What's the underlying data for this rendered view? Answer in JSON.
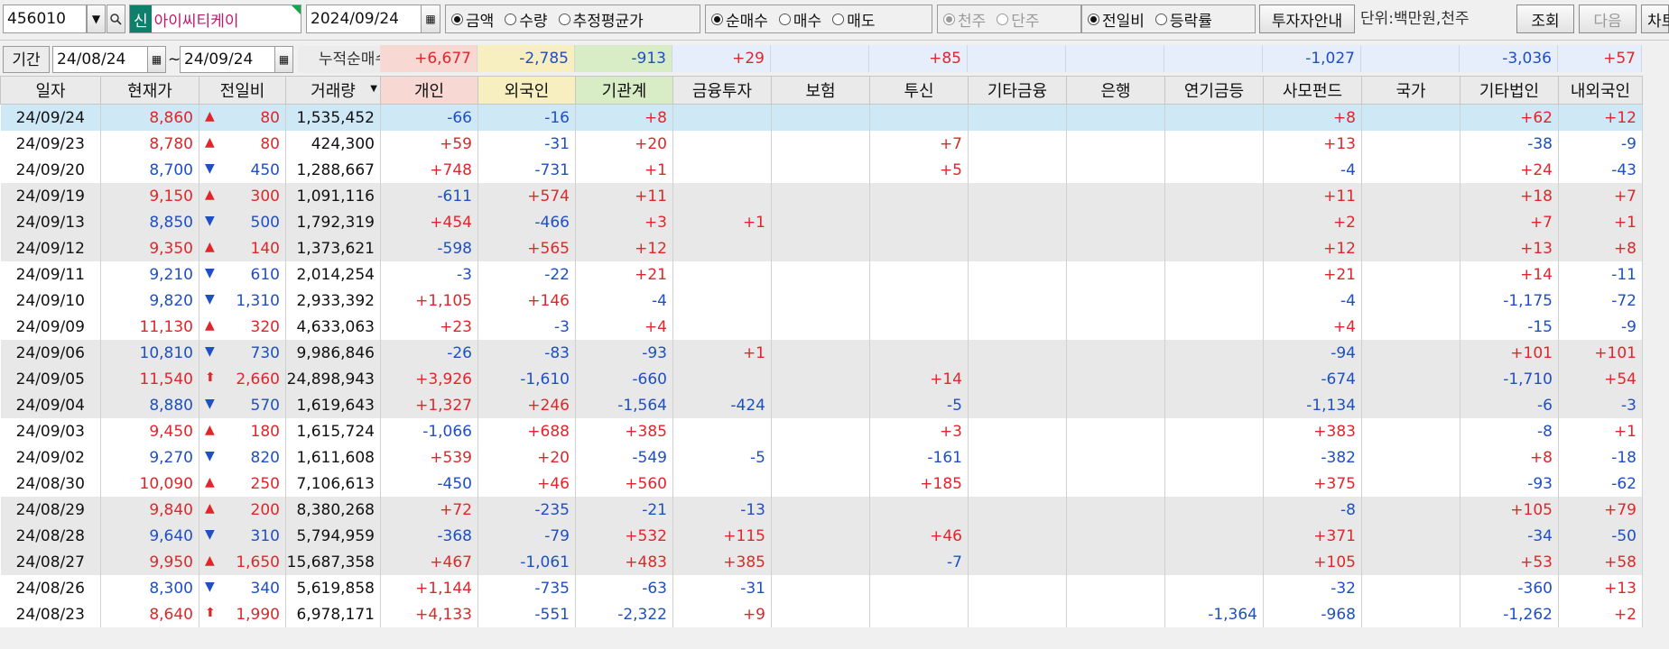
{
  "toolbar": {
    "code": "456010",
    "market_badge": "신",
    "stock_name": "아이씨티케이",
    "date": "2024/09/24",
    "radio_groups": [
      {
        "options": [
          "금액",
          "수량",
          "추정평균가"
        ],
        "selected": 0
      },
      {
        "options": [
          "순매수",
          "매수",
          "매도"
        ],
        "selected": 0
      },
      {
        "options": [
          "천주",
          "단주"
        ],
        "selected": 0,
        "disabled": true
      },
      {
        "options": [
          "전일비",
          "등락률"
        ],
        "selected": 0
      }
    ],
    "investor_button": "투자자안내",
    "unit_label": "단위:백만원,천주",
    "search_button": "조회",
    "next_button": "다음",
    "chart_button": "차트"
  },
  "period": {
    "label": "기간",
    "from": "24/08/24",
    "tilde": "~",
    "to": "24/09/24",
    "cum_label": "누적순매수"
  },
  "summary": [
    "+6,677",
    "-2,785",
    "-913",
    "+29",
    "",
    "+85",
    "",
    "",
    "",
    "-1,027",
    "",
    "-3,036",
    "+57"
  ],
  "colors": {
    "up": "#e0262b",
    "down": "#1f4fc4",
    "selected_row": "#cfe8f5",
    "gray_row": "#e8e8e8"
  },
  "table": {
    "headers": [
      "일자",
      "현재가",
      "전일비",
      "거래량",
      "개인",
      "외국인",
      "기관계",
      "금융투자",
      "보험",
      "투신",
      "기타금융",
      "은행",
      "연기금등",
      "사모펀드",
      "국가",
      "기타법인",
      "내외국인"
    ],
    "rows": [
      {
        "shade": "sel",
        "date": "24/09/24",
        "price": "8,860",
        "dir": "up",
        "arrow": "▲",
        "change": "80",
        "volume": "1,535,452",
        "vals": [
          "-66",
          "-16",
          "+8",
          "",
          "",
          "",
          "",
          "",
          "",
          "+8",
          "",
          "+62",
          "+12"
        ]
      },
      {
        "shade": "white",
        "date": "24/09/23",
        "price": "8,780",
        "dir": "up",
        "arrow": "▲",
        "change": "80",
        "volume": "424,300",
        "vals": [
          "+59",
          "-31",
          "+20",
          "",
          "",
          "+7",
          "",
          "",
          "",
          "+13",
          "",
          "-38",
          "-9"
        ]
      },
      {
        "shade": "white",
        "date": "24/09/20",
        "price": "8,700",
        "dir": "down",
        "arrow": "▼",
        "change": "450",
        "volume": "1,288,667",
        "vals": [
          "+748",
          "-731",
          "+1",
          "",
          "",
          "+5",
          "",
          "",
          "",
          "-4",
          "",
          "+24",
          "-43"
        ]
      },
      {
        "shade": "gray",
        "date": "24/09/19",
        "price": "9,150",
        "dir": "up",
        "arrow": "▲",
        "change": "300",
        "volume": "1,091,116",
        "vals": [
          "-611",
          "+574",
          "+11",
          "",
          "",
          "",
          "",
          "",
          "",
          "+11",
          "",
          "+18",
          "+7"
        ]
      },
      {
        "shade": "gray",
        "date": "24/09/13",
        "price": "8,850",
        "dir": "down",
        "arrow": "▼",
        "change": "500",
        "volume": "1,792,319",
        "vals": [
          "+454",
          "-466",
          "+3",
          "+1",
          "",
          "",
          "",
          "",
          "",
          "+2",
          "",
          "+7",
          "+1"
        ]
      },
      {
        "shade": "gray",
        "date": "24/09/12",
        "price": "9,350",
        "dir": "up",
        "arrow": "▲",
        "change": "140",
        "volume": "1,373,621",
        "vals": [
          "-598",
          "+565",
          "+12",
          "",
          "",
          "",
          "",
          "",
          "",
          "+12",
          "",
          "+13",
          "+8"
        ]
      },
      {
        "shade": "white",
        "date": "24/09/11",
        "price": "9,210",
        "dir": "down",
        "arrow": "▼",
        "change": "610",
        "volume": "2,014,254",
        "vals": [
          "-3",
          "-22",
          "+21",
          "",
          "",
          "",
          "",
          "",
          "",
          "+21",
          "",
          "+14",
          "-11"
        ]
      },
      {
        "shade": "white",
        "date": "24/09/10",
        "price": "9,820",
        "dir": "down",
        "arrow": "▼",
        "change": "1,310",
        "volume": "2,933,392",
        "vals": [
          "+1,105",
          "+146",
          "-4",
          "",
          "",
          "",
          "",
          "",
          "",
          "-4",
          "",
          "-1,175",
          "-72"
        ]
      },
      {
        "shade": "white",
        "date": "24/09/09",
        "price": "11,130",
        "dir": "up",
        "arrow": "▲",
        "change": "320",
        "volume": "4,633,063",
        "vals": [
          "+23",
          "-3",
          "+4",
          "",
          "",
          "",
          "",
          "",
          "",
          "+4",
          "",
          "-15",
          "-9"
        ]
      },
      {
        "shade": "gray",
        "date": "24/09/06",
        "price": "10,810",
        "dir": "down",
        "arrow": "▼",
        "change": "730",
        "volume": "9,986,846",
        "vals": [
          "-26",
          "-83",
          "-93",
          "+1",
          "",
          "",
          "",
          "",
          "",
          "-94",
          "",
          "+101",
          "+101"
        ]
      },
      {
        "shade": "gray",
        "date": "24/09/05",
        "price": "11,540",
        "dir": "up",
        "arrow": "⬆",
        "change": "2,660",
        "volume": "24,898,943",
        "vals": [
          "+3,926",
          "-1,610",
          "-660",
          "",
          "",
          "+14",
          "",
          "",
          "",
          "-674",
          "",
          "-1,710",
          "+54"
        ]
      },
      {
        "shade": "gray",
        "date": "24/09/04",
        "price": "8,880",
        "dir": "down",
        "arrow": "▼",
        "change": "570",
        "volume": "1,619,643",
        "vals": [
          "+1,327",
          "+246",
          "-1,564",
          "-424",
          "",
          "-5",
          "",
          "",
          "",
          "-1,134",
          "",
          "-6",
          "-3"
        ]
      },
      {
        "shade": "white",
        "date": "24/09/03",
        "price": "9,450",
        "dir": "up",
        "arrow": "▲",
        "change": "180",
        "volume": "1,615,724",
        "vals": [
          "-1,066",
          "+688",
          "+385",
          "",
          "",
          "+3",
          "",
          "",
          "",
          "+383",
          "",
          "-8",
          "+1"
        ]
      },
      {
        "shade": "white",
        "date": "24/09/02",
        "price": "9,270",
        "dir": "down",
        "arrow": "▼",
        "change": "820",
        "volume": "1,611,608",
        "vals": [
          "+539",
          "+20",
          "-549",
          "-5",
          "",
          "-161",
          "",
          "",
          "",
          "-382",
          "",
          "+8",
          "-18"
        ]
      },
      {
        "shade": "white",
        "date": "24/08/30",
        "price": "10,090",
        "dir": "up",
        "arrow": "▲",
        "change": "250",
        "volume": "7,106,613",
        "vals": [
          "-450",
          "+46",
          "+560",
          "",
          "",
          "+185",
          "",
          "",
          "",
          "+375",
          "",
          "-93",
          "-62"
        ]
      },
      {
        "shade": "gray",
        "date": "24/08/29",
        "price": "9,840",
        "dir": "up",
        "arrow": "▲",
        "change": "200",
        "volume": "8,380,268",
        "vals": [
          "+72",
          "-235",
          "-21",
          "-13",
          "",
          "",
          "",
          "",
          "",
          "-8",
          "",
          "+105",
          "+79"
        ]
      },
      {
        "shade": "gray",
        "date": "24/08/28",
        "price": "9,640",
        "dir": "down",
        "arrow": "▼",
        "change": "310",
        "volume": "5,794,959",
        "vals": [
          "-368",
          "-79",
          "+532",
          "+115",
          "",
          "+46",
          "",
          "",
          "",
          "+371",
          "",
          "-34",
          "-50"
        ]
      },
      {
        "shade": "gray",
        "date": "24/08/27",
        "price": "9,950",
        "dir": "up",
        "arrow": "▲",
        "change": "1,650",
        "volume": "15,687,358",
        "vals": [
          "+467",
          "-1,061",
          "+483",
          "+385",
          "",
          "-7",
          "",
          "",
          "",
          "+105",
          "",
          "+53",
          "+58"
        ]
      },
      {
        "shade": "white",
        "date": "24/08/26",
        "price": "8,300",
        "dir": "down",
        "arrow": "▼",
        "change": "340",
        "volume": "5,619,858",
        "vals": [
          "+1,144",
          "-735",
          "-63",
          "-31",
          "",
          "",
          "",
          "",
          "",
          "-32",
          "",
          "-360",
          "+13"
        ]
      },
      {
        "shade": "white",
        "date": "24/08/23",
        "price": "8,640",
        "dir": "up",
        "arrow": "⬆",
        "change": "1,990",
        "volume": "6,978,171",
        "vals": [
          "+4,133",
          "-551",
          "-2,322",
          "+9",
          "",
          "",
          "",
          "",
          "-1,364",
          "-968",
          "",
          "-1,262",
          "+2"
        ]
      }
    ]
  }
}
